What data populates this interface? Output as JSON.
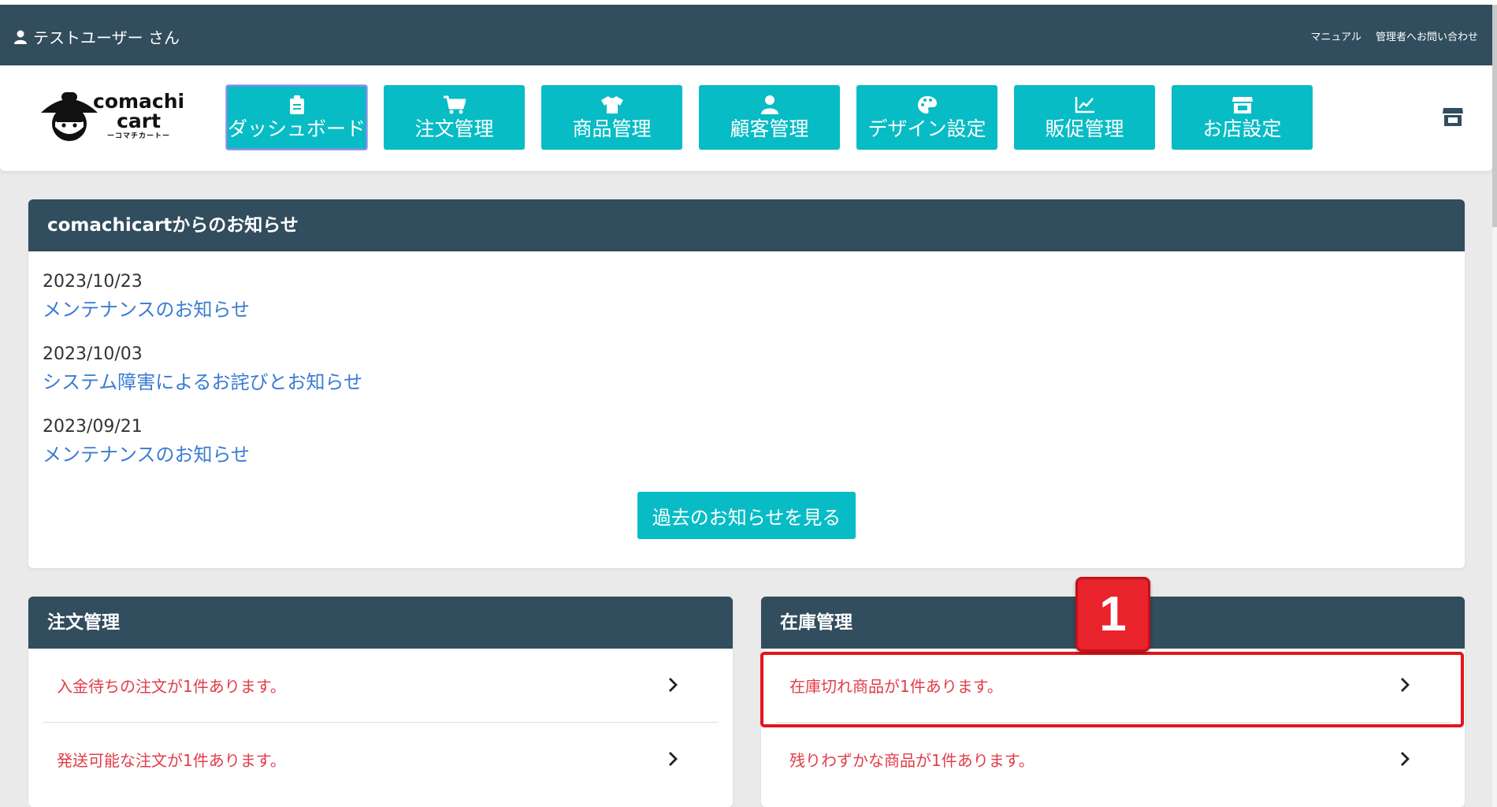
{
  "topbar": {
    "user": "テストユーザー さん",
    "links": [
      "マニュアル",
      "管理者へお問い合わせ"
    ]
  },
  "logo": {
    "line1": "comachi",
    "line2": "cart",
    "line3": "ーコマチカートー"
  },
  "nav": [
    {
      "label": "ダッシュボード",
      "icon": "clipboard-icon",
      "active": true
    },
    {
      "label": "注文管理",
      "icon": "cart-icon"
    },
    {
      "label": "商品管理",
      "icon": "tshirt-icon"
    },
    {
      "label": "顧客管理",
      "icon": "user-icon"
    },
    {
      "label": "デザイン設定",
      "icon": "palette-icon"
    },
    {
      "label": "販促管理",
      "icon": "chart-line-icon"
    },
    {
      "label": "お店設定",
      "icon": "store-icon"
    }
  ],
  "news": {
    "title": "comachicartからのお知らせ",
    "items": [
      {
        "date": "2023/10/23",
        "title": "メンテナンスのお知らせ"
      },
      {
        "date": "2023/10/03",
        "title": "システム障害によるお詫びとお知らせ"
      },
      {
        "date": "2023/09/21",
        "title": "メンテナンスのお知らせ"
      }
    ],
    "more_label": "過去のお知らせを見る"
  },
  "orders": {
    "title": "注文管理",
    "rows": [
      "入金待ちの注文が1件あります。",
      "発送可能な注文が1件あります。"
    ]
  },
  "stock": {
    "title": "在庫管理",
    "rows": [
      "在庫切れ商品が1件あります。",
      "残りわずかな商品が1件あります。"
    ]
  },
  "annotation": {
    "badge": "1",
    "color": "#e8131c"
  },
  "colors": {
    "header": "#314d5e",
    "accent": "#08bcc5",
    "alert": "#e23c48",
    "link": "#3a7bd5"
  }
}
